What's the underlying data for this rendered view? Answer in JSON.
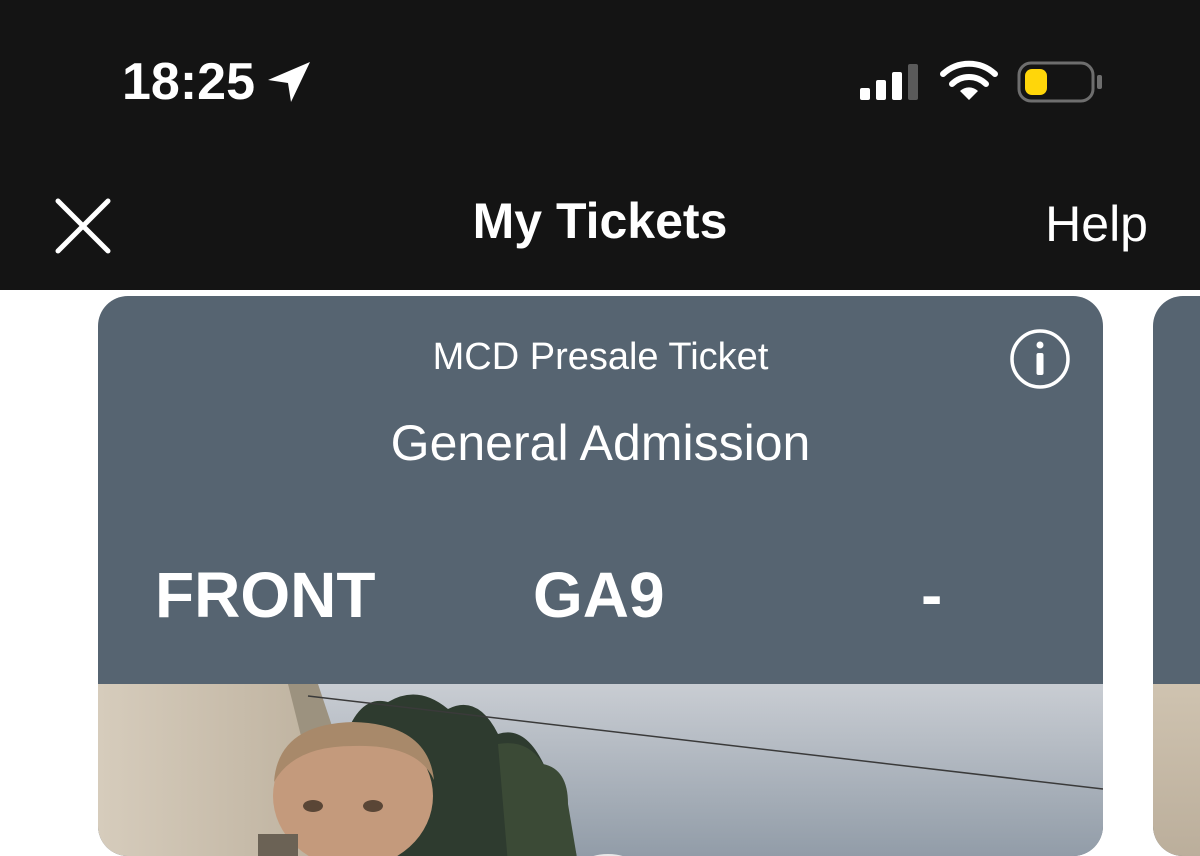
{
  "status_bar": {
    "time": "18:25",
    "icons": [
      "location-arrow-icon",
      "cellular-signal-icon",
      "wifi-icon",
      "battery-low-icon"
    ],
    "battery_color": "#FFD60A"
  },
  "nav": {
    "title": "My Tickets",
    "help_label": "Help",
    "close_icon": "close-icon"
  },
  "ticket": {
    "type": "MCD Presale Ticket",
    "admission": "General Admission",
    "section": "FRONT",
    "row": "GA9",
    "seat": "-",
    "info_icon": "info-icon",
    "card_color": "#566471"
  }
}
